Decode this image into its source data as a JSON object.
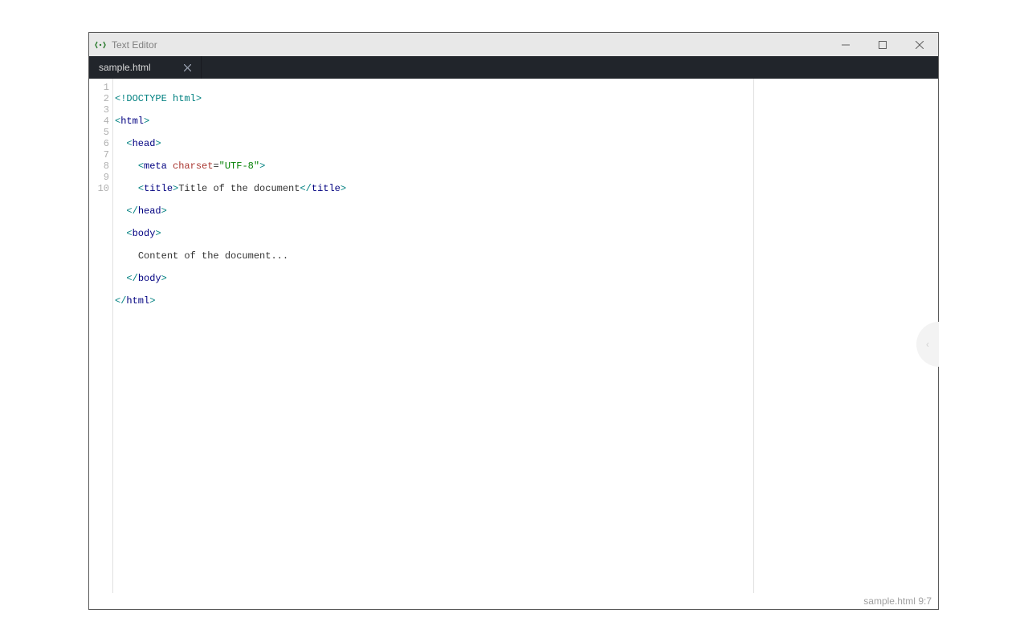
{
  "app": {
    "title": "Text Editor"
  },
  "tabs": [
    {
      "label": "sample.html"
    }
  ],
  "gutter": [
    "1",
    "2",
    "3",
    "4",
    "5",
    "6",
    "7",
    "8",
    "9",
    "10"
  ],
  "code": {
    "l1_doctype": "<!DOCTYPE html>",
    "l2_open": "<",
    "l2_tag": "html",
    "l2_close": ">",
    "l3_indent": "  ",
    "l3_open": "<",
    "l3_tag": "head",
    "l3_close": ">",
    "l4_indent": "    ",
    "l4_open": "<",
    "l4_tag": "meta",
    "l4_sp": " ",
    "l4_attr": "charset",
    "l4_eq": "=",
    "l4_val": "\"UTF-8\"",
    "l4_close": ">",
    "l5_indent": "    ",
    "l5_open": "<",
    "l5_tag": "title",
    "l5_close": ">",
    "l5_text": "Title of the document",
    "l5_open2": "</",
    "l5_tag2": "title",
    "l5_close2": ">",
    "l6_indent": "  ",
    "l6_open": "</",
    "l6_tag": "head",
    "l6_close": ">",
    "l7_indent": "  ",
    "l7_open": "<",
    "l7_tag": "body",
    "l7_close": ">",
    "l8_indent": "    ",
    "l8_text": "Content of the document...",
    "l9_indent": "  ",
    "l9_open": "</",
    "l9_tag": "body",
    "l9_close": ">",
    "l10_open": "</",
    "l10_tag": "html",
    "l10_close": ">"
  },
  "status": {
    "file": "sample.html",
    "pos": "9:7"
  }
}
